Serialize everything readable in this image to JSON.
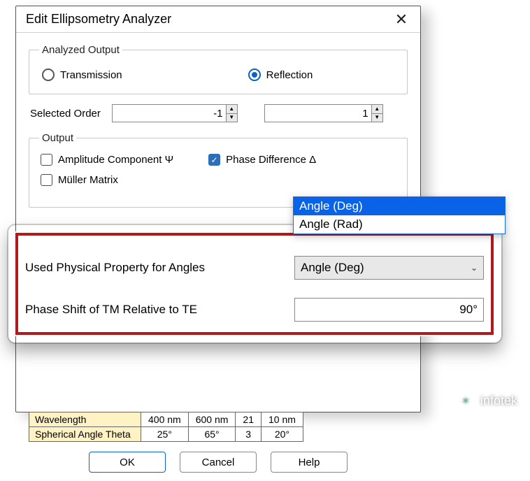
{
  "dialog": {
    "title": "Edit Ellipsometry Analyzer",
    "analyzed_output": {
      "legend": "Analyzed Output",
      "transmission": "Transmission",
      "reflection": "Reflection",
      "selected": "reflection"
    },
    "selected_order": {
      "label": "Selected Order",
      "value1": "-1",
      "value2": "1"
    },
    "output": {
      "legend": "Output",
      "amplitude": "Amplitude Component Ψ",
      "phase_diff": "Phase Difference Δ",
      "muller": "Müller Matrix"
    }
  },
  "highlight": {
    "angles_label": "Used Physical Property for Angles",
    "angles_value": "Angle (Deg)",
    "phase_label": "Phase Shift of TM Relative to TE",
    "phase_value": "90°"
  },
  "dropdown": {
    "opt0": "Angle (Deg)",
    "opt1": "Angle (Rad)"
  },
  "table": {
    "row0": {
      "name": "Wavelength",
      "c0": "400 nm",
      "c1": "600 nm",
      "c2": "21",
      "c3": "10 nm"
    },
    "row1": {
      "name": "Spherical Angle Theta",
      "c0": "25°",
      "c1": "65°",
      "c2": "3",
      "c3": "20°"
    }
  },
  "buttons": {
    "ok": "OK",
    "cancel": "Cancel",
    "help": "Help"
  },
  "watermark": "infotek"
}
